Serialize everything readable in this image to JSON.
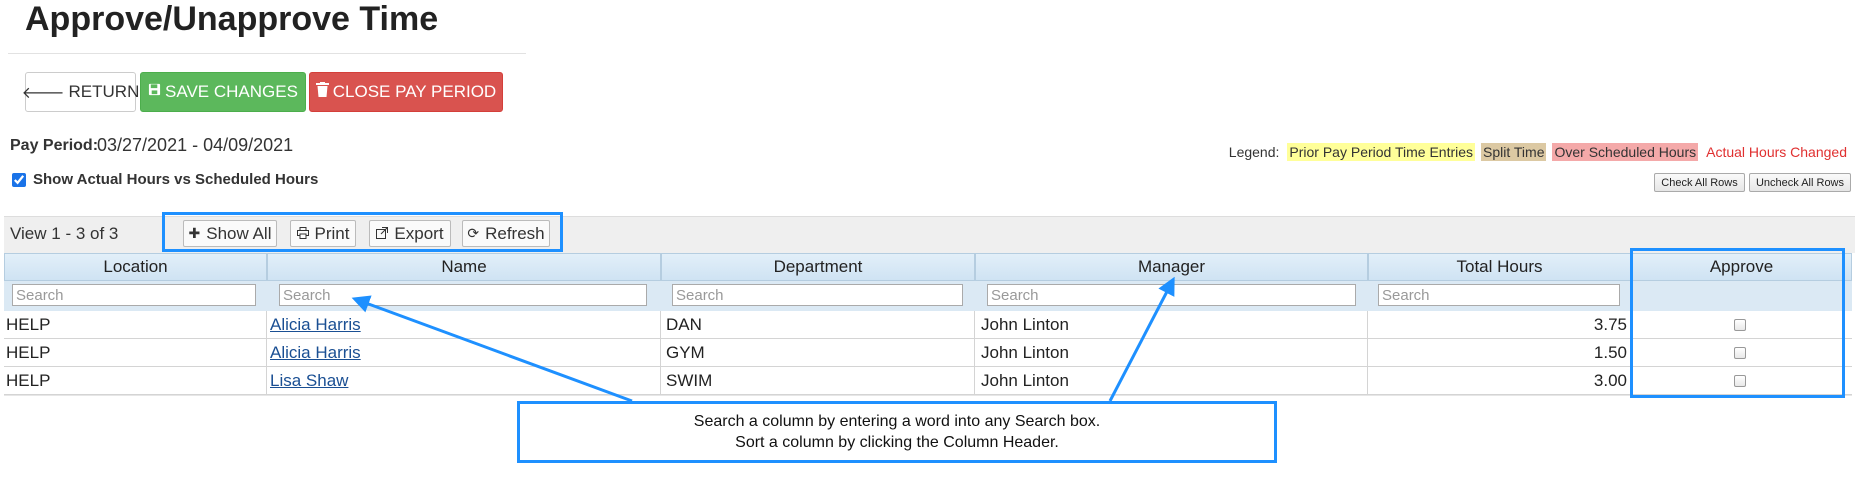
{
  "page": {
    "title": "Approve/Unapprove Time"
  },
  "actions": {
    "return_label": "RETURN",
    "save_label": "SAVE CHANGES",
    "close_label": "CLOSE PAY PERIOD"
  },
  "pay_period": {
    "label": "Pay Period:",
    "value": "03/27/2021 - 04/09/2021"
  },
  "show_actual": {
    "label": "Show Actual Hours vs Scheduled Hours",
    "checked": true
  },
  "legend": {
    "label": "Legend:",
    "prior": "Prior Pay Period Time Entries",
    "split": "Split Time",
    "over": "Over Scheduled Hours",
    "actual": "Actual Hours Changed"
  },
  "row_buttons": {
    "check_all": "Check All Rows",
    "uncheck_all": "Uncheck All Rows"
  },
  "grid": {
    "view_text": "View 1 - 3 of 3",
    "toolbar": {
      "show_all": "Show All",
      "print": "Print",
      "export": "Export",
      "refresh": "Refresh"
    },
    "columns": [
      "Location",
      "Name",
      "Department",
      "Manager",
      "Total Hours",
      "Approve"
    ],
    "search_placeholder": "Search",
    "rows": [
      {
        "location": "HELP",
        "name": "Alicia Harris",
        "department": "DAN",
        "manager": "John Linton",
        "total_hours": "3.75",
        "approved": false
      },
      {
        "location": "HELP",
        "name": "Alicia Harris",
        "department": "GYM",
        "manager": "John Linton",
        "total_hours": "1.50",
        "approved": false
      },
      {
        "location": "HELP",
        "name": "Lisa Shaw",
        "department": "SWIM",
        "manager": "John Linton",
        "total_hours": "3.00",
        "approved": false
      }
    ]
  },
  "callout": {
    "line1": "Search a column by entering a word into any Search box.",
    "line2": "Sort a column by clicking the Column Header."
  },
  "colors": {
    "save": "#5cb85c",
    "close": "#d9534f",
    "highlight": "#1e90ff",
    "link": "#1a4f93"
  }
}
